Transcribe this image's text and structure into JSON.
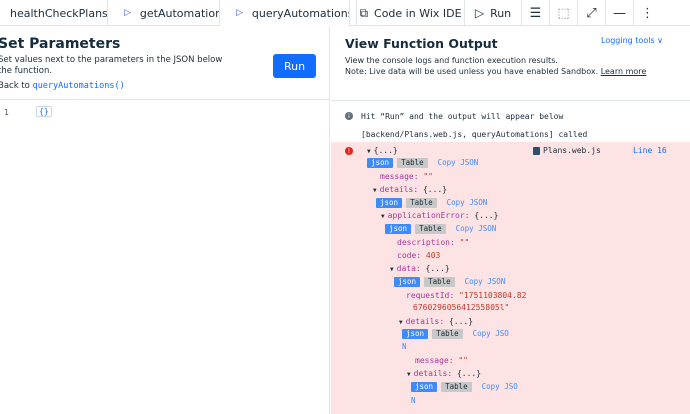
{
  "tabs": [
    {
      "label": "healthCheckPlans"
    },
    {
      "label": "getAutomation"
    },
    {
      "label": "queryAutomations"
    }
  ],
  "toolbar": {
    "ide_label": "Code in Wix IDE",
    "run_label": "Run"
  },
  "left": {
    "title": "Set Parameters",
    "description": "Set values next to the parameters in the JSON below the function.",
    "back_prefix": "Back to ",
    "back_link": "queryAutomations()",
    "run_button": "Run",
    "editor": {
      "line_number": "1",
      "code": "{}"
    }
  },
  "right": {
    "title": "View Function Output",
    "desc_line1": "View the console logs and function execution results.",
    "desc_line2": "Note: Live data will be used unless you have enabled Sandbox. ",
    "learn_more": "Learn more",
    "logging_tools": "Logging tools ∨",
    "info_text": "Hit “Run” and the output will appear below",
    "called_text": "[backend/Plans.web.js, queryAutomations] called",
    "error_file": "Plans.web.js",
    "error_line": "Line 16",
    "tree": {
      "root": "{...}",
      "json": "json",
      "table": "Table",
      "copy_json": "Copy JSON",
      "copy_jso": "Copy JSO",
      "n": "N",
      "message_key": "message:",
      "message_val": "\"\"",
      "details_key": "details:",
      "details_val": "{...}",
      "app_error_key": "applicationError:",
      "app_error_val": "{...}",
      "description_key": "description:",
      "description_val": "\"\"",
      "code_key": "code:",
      "code_val": "403",
      "data_key": "data:",
      "data_val": "{...}",
      "request_key": "requestId:",
      "request_val_1": "\"1751103804.82",
      "request_val_2": "676029605641255805l\"",
      "details2_key": "details:",
      "details2_val": "{...}",
      "message2_key": "message:",
      "message2_val": "\"\"",
      "details3_key": "details:",
      "details3_val": "{...}"
    }
  }
}
